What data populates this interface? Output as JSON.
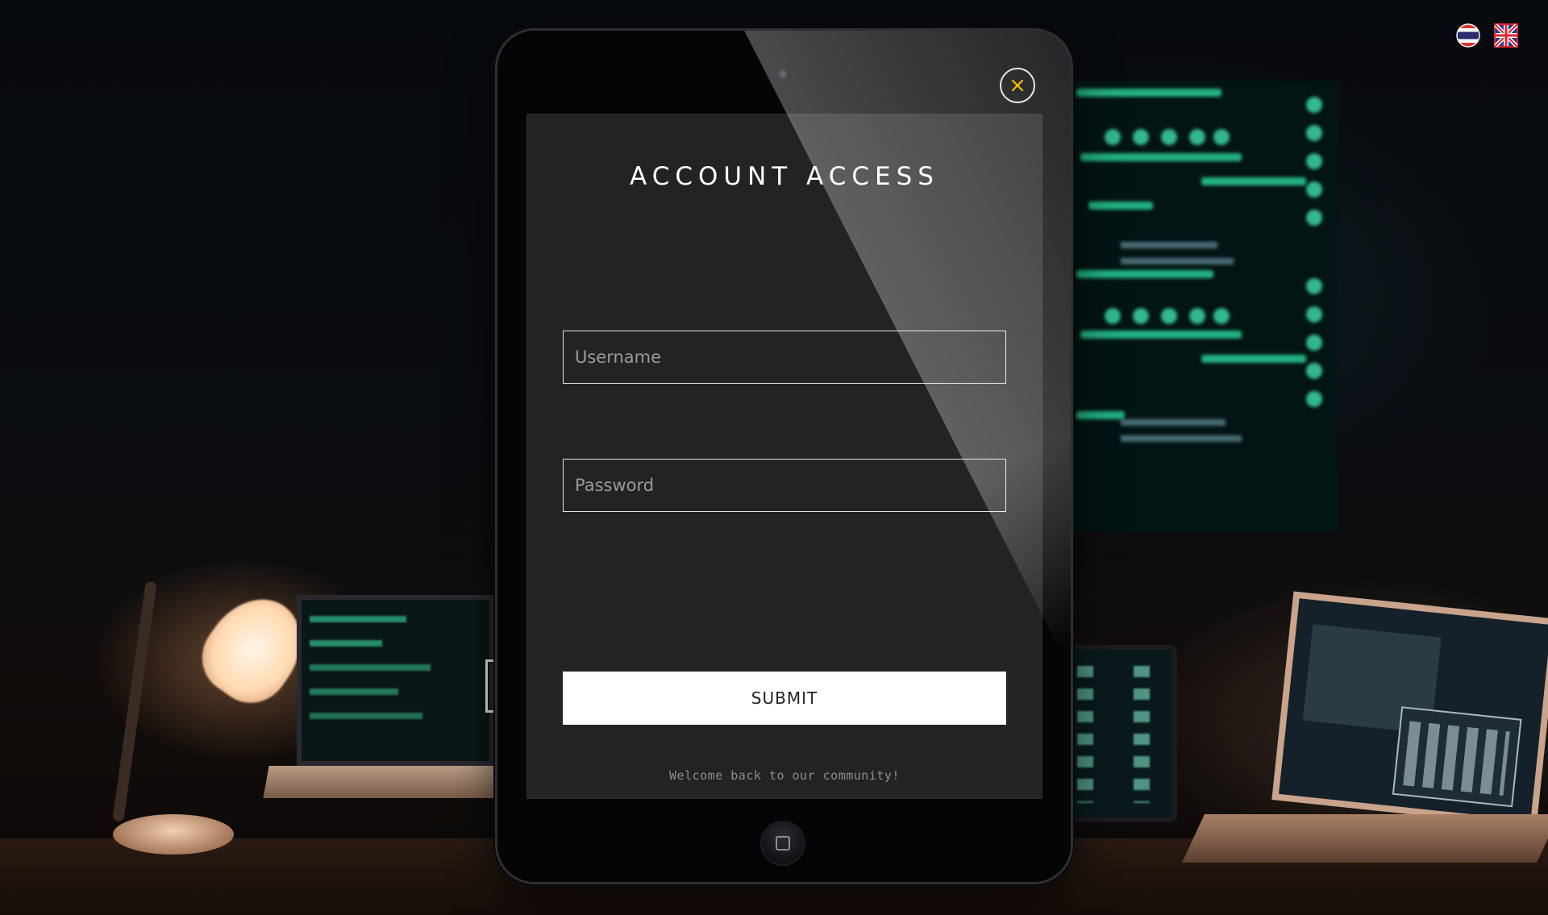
{
  "form": {
    "title": "ACCOUNT ACCESS",
    "username_placeholder": "Username",
    "username_value": "",
    "password_placeholder": "Password",
    "password_value": "",
    "submit_label": "SUBMIT",
    "welcome_message": "Welcome back to our community!"
  },
  "icons": {
    "close": "close-icon",
    "home": "home-button-icon",
    "flag_th": "thai-flag-icon",
    "flag_en": "uk-flag-icon"
  },
  "colors": {
    "accent": "#f5c400",
    "screen_bg": "#232325",
    "submit_bg": "#ffffff"
  }
}
